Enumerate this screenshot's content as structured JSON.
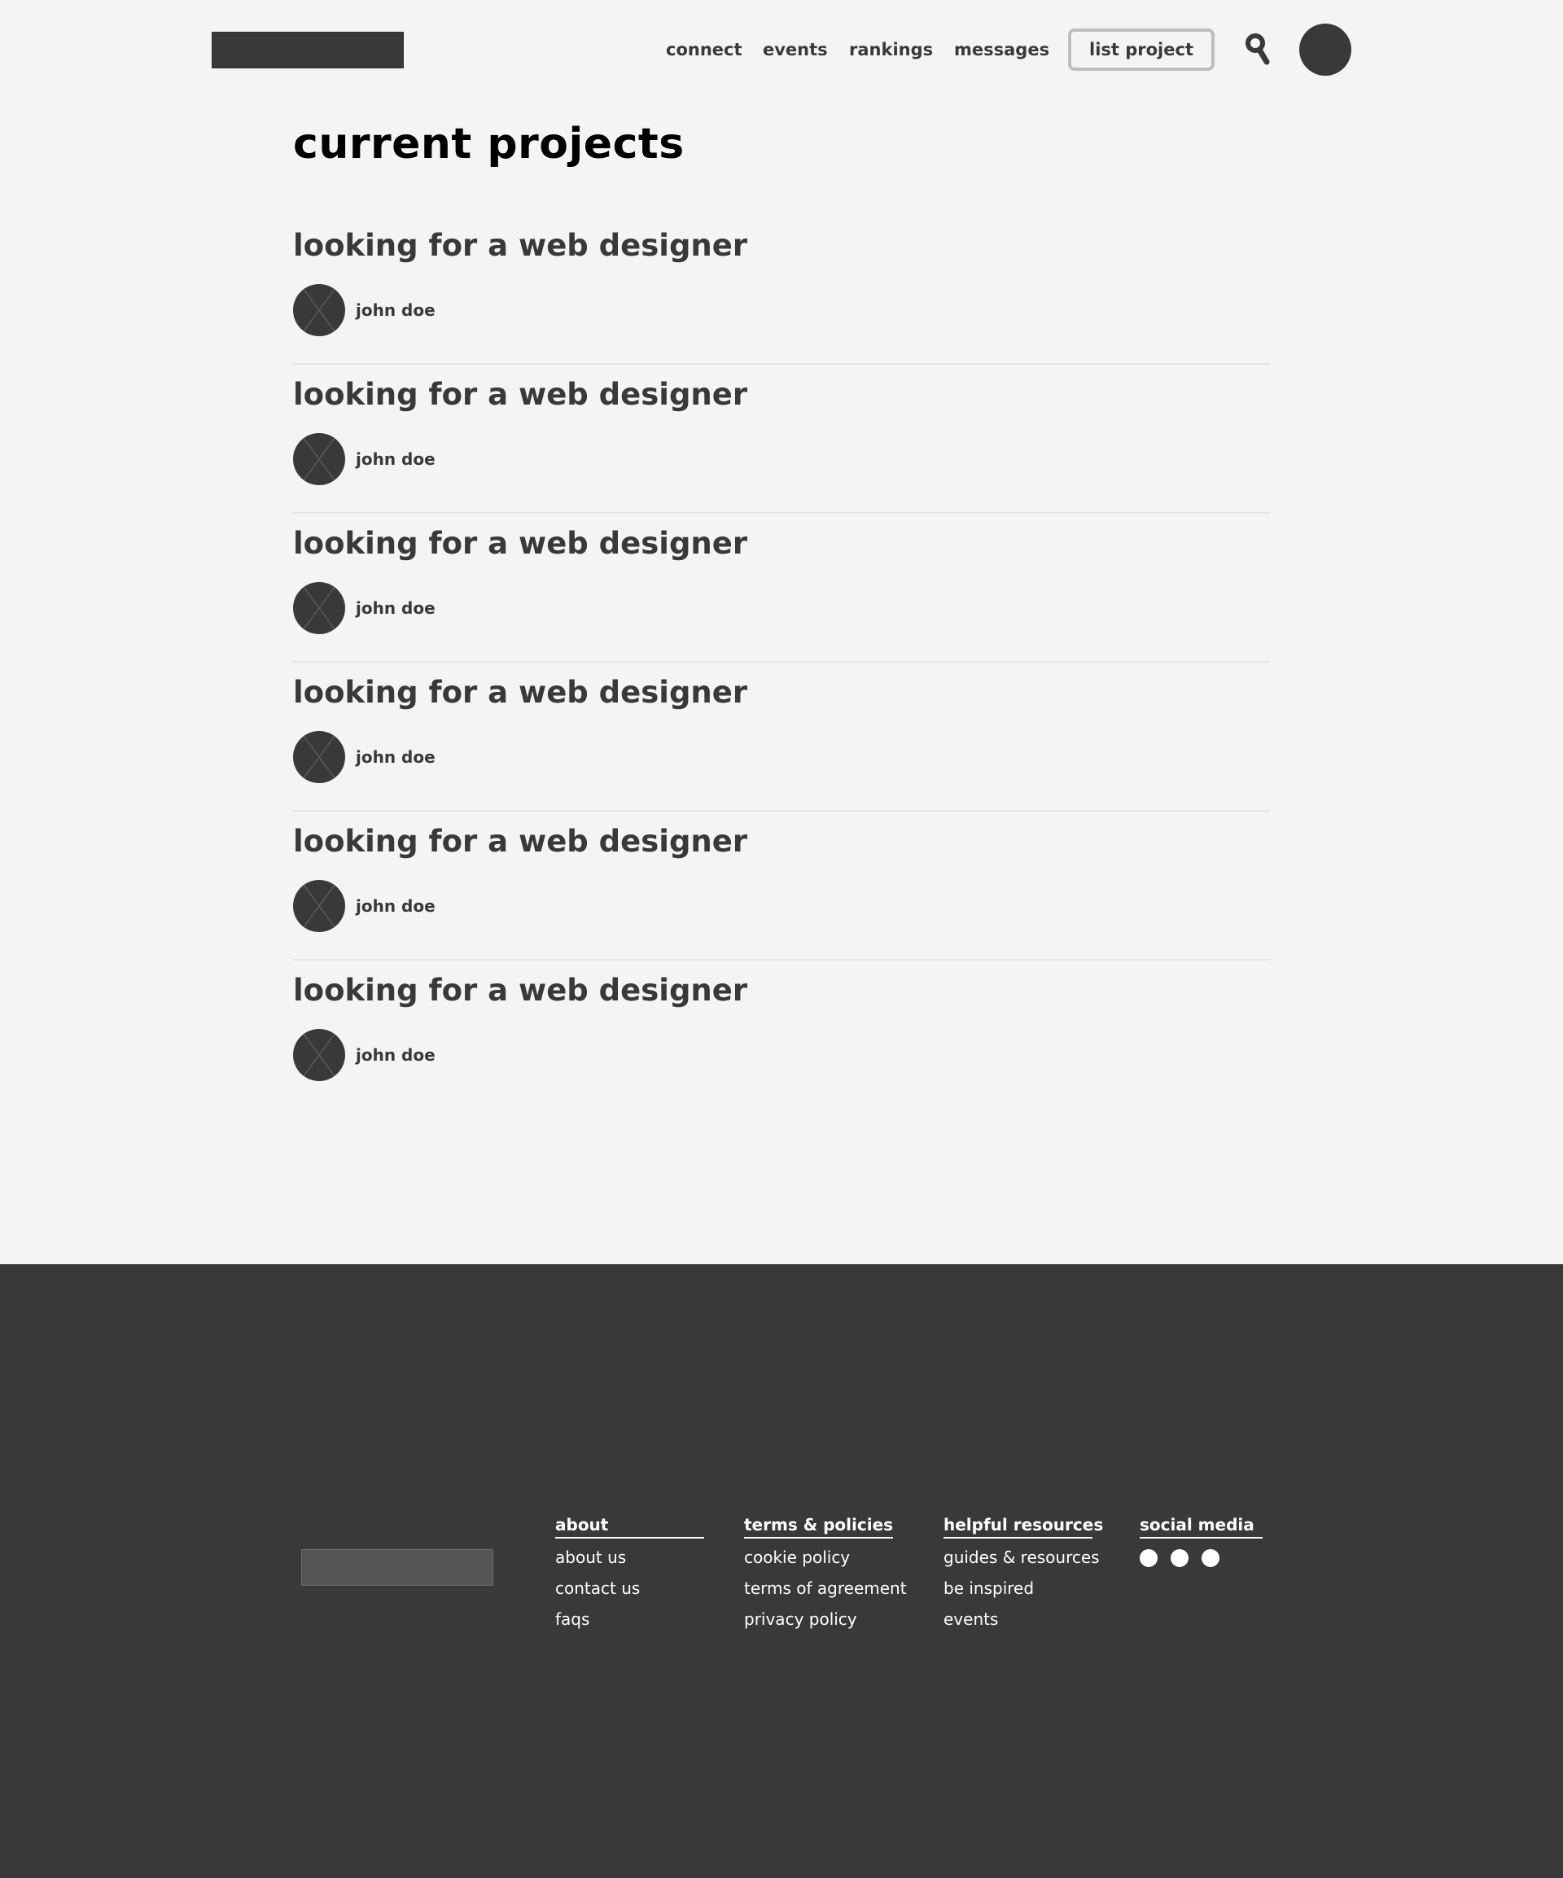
{
  "header": {
    "nav": {
      "connect": "connect",
      "events": "events",
      "rankings": "rankings",
      "messages": "messages"
    },
    "list_project_label": "list project",
    "search_icon": "search-icon",
    "avatar": "user-avatar"
  },
  "main": {
    "title": "current projects",
    "projects": [
      {
        "title": "looking for a web designer",
        "user": "john doe"
      },
      {
        "title": "looking for a web designer",
        "user": "john doe"
      },
      {
        "title": "looking for a web designer",
        "user": "john doe"
      },
      {
        "title": "looking for a web designer",
        "user": "john doe"
      },
      {
        "title": "looking for a web designer",
        "user": "john doe"
      },
      {
        "title": "looking for a web designer",
        "user": "john doe"
      }
    ]
  },
  "footer": {
    "about": {
      "heading": "about",
      "links": [
        "about us",
        "contact us",
        "faqs"
      ]
    },
    "terms": {
      "heading": "terms & policies",
      "links": [
        "cookie policy",
        "terms of agreement",
        "privacy policy"
      ]
    },
    "helpful": {
      "heading": "helpful resources",
      "links": [
        "guides & resources",
        "be inspired",
        "events"
      ]
    },
    "social": {
      "heading": "social media",
      "icons": [
        "social-icon",
        "social-icon",
        "social-icon"
      ]
    }
  },
  "colors": {
    "background": "#f4f4f3",
    "text": "#393939",
    "footer_bg": "#393939",
    "button_border": "#bdbdbd"
  }
}
